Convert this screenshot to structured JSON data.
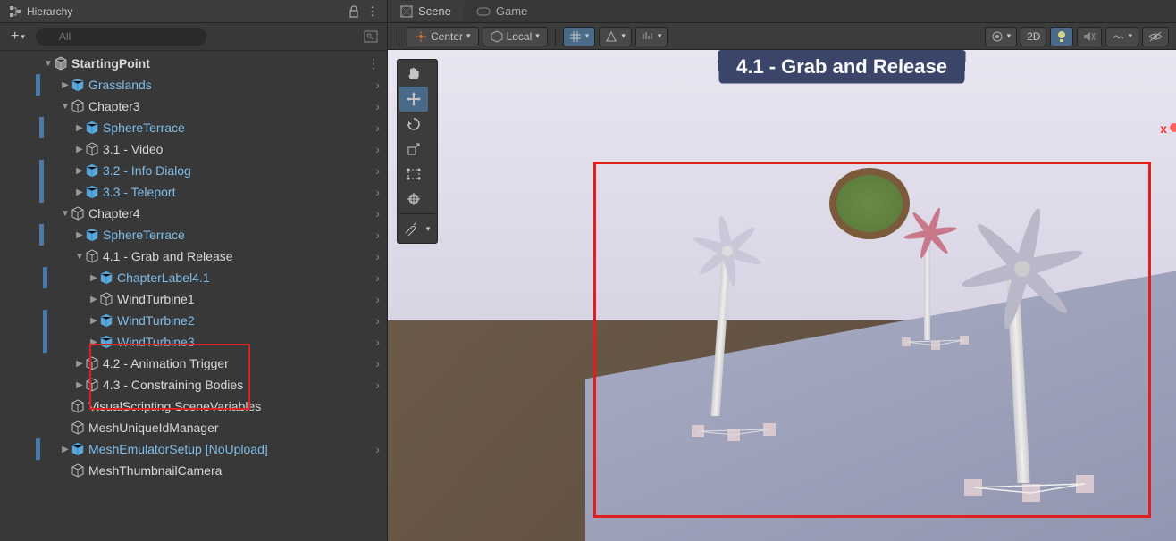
{
  "hierarchy": {
    "title": "Hierarchy",
    "search_placeholder": "All",
    "root": "StartingPoint",
    "items": [
      {
        "label": "Grasslands",
        "prefab": true,
        "depth": 1,
        "expandable": true
      },
      {
        "label": "Chapter3",
        "prefab": false,
        "depth": 1,
        "expandable": true,
        "expanded": true
      },
      {
        "label": "SphereTerrace",
        "prefab": true,
        "depth": 2,
        "expandable": true
      },
      {
        "label": "3.1 - Video",
        "prefab": false,
        "depth": 2,
        "expandable": true
      },
      {
        "label": "3.2 - Info Dialog",
        "prefab": true,
        "depth": 2,
        "expandable": true
      },
      {
        "label": "3.3 - Teleport",
        "prefab": true,
        "depth": 2,
        "expandable": true
      },
      {
        "label": "Chapter4",
        "prefab": false,
        "depth": 1,
        "expandable": true,
        "expanded": true
      },
      {
        "label": "SphereTerrace",
        "prefab": true,
        "depth": 2,
        "expandable": true
      },
      {
        "label": "4.1 - Grab and Release",
        "prefab": false,
        "depth": 2,
        "expandable": true,
        "expanded": true
      },
      {
        "label": "ChapterLabel4.1",
        "prefab": true,
        "depth": 3,
        "expandable": true
      },
      {
        "label": "WindTurbine1",
        "prefab": false,
        "depth": 3,
        "expandable": true
      },
      {
        "label": "WindTurbine2",
        "prefab": true,
        "depth": 3,
        "expandable": true
      },
      {
        "label": "WindTurbine3",
        "prefab": true,
        "depth": 3,
        "expandable": true
      },
      {
        "label": "4.2 - Animation Trigger",
        "prefab": false,
        "depth": 2,
        "expandable": true
      },
      {
        "label": "4.3 - Constraining Bodies",
        "prefab": false,
        "depth": 2,
        "expandable": true
      },
      {
        "label": "VisualScripting SceneVariables",
        "prefab": false,
        "depth": 1,
        "expandable": false
      },
      {
        "label": "MeshUniqueIdManager",
        "prefab": false,
        "depth": 1,
        "expandable": false
      },
      {
        "label": "MeshEmulatorSetup [NoUpload]",
        "prefab": true,
        "depth": 1,
        "expandable": true
      },
      {
        "label": "MeshThumbnailCamera",
        "prefab": false,
        "depth": 1,
        "expandable": false
      }
    ]
  },
  "scene": {
    "tab_scene": "Scene",
    "tab_game": "Game",
    "pivot_label": "Center",
    "space_label": "Local",
    "mode_2d": "2D",
    "banner": "4.1 - Grab and Release"
  }
}
